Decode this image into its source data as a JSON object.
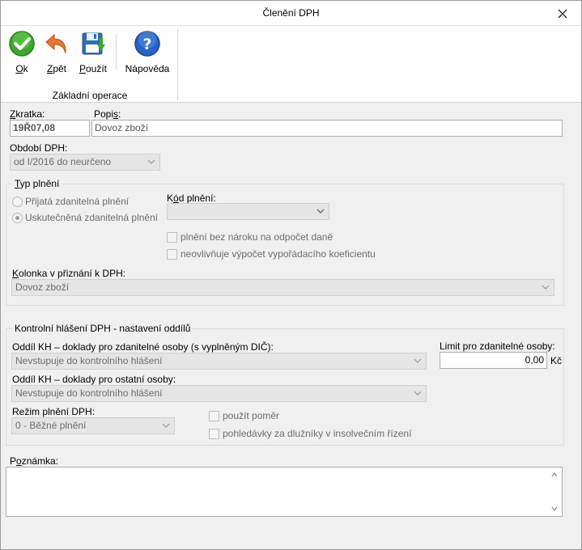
{
  "window": {
    "title": "Členění DPH"
  },
  "ribbon": {
    "buttons": {
      "ok": {
        "mnemonic": "O",
        "rest": "k"
      },
      "zpet": {
        "mnemonic": "Z",
        "rest": "pět"
      },
      "pouzit": {
        "mnemonic": "P",
        "rest": "oužít"
      },
      "napoveda": {
        "label": "Nápověda"
      }
    },
    "group_label": "Základní operace"
  },
  "form": {
    "zkratka": {
      "label_m": "Z",
      "label_rest": "kratka:",
      "value": "19Ř07,08"
    },
    "popis": {
      "label_a": "Popi",
      "label_m": "s",
      "label_rest": ":",
      "value": "Dovoz zboží"
    },
    "obdobi": {
      "label": "Období DPH:",
      "value": "od I/2016 do neurčeno"
    },
    "typ_plneni": {
      "title_m": "T",
      "title_rest": "yp plnění",
      "radio1": "Přijatá zdanitelná plnění",
      "radio2": "Uskutečněná zdanitelná plnění",
      "kod_label_a": "K",
      "kod_label_m": "ó",
      "kod_label_rest": "d plnění:",
      "kod_value": "",
      "check1": "plnění bez nároku na odpočet daně",
      "check2": "neovlivňuje výpočet vypořádacího koeficientu",
      "kolonka_label_m": "K",
      "kolonka_label_rest": "olonka v přiznání k DPH:",
      "kolonka_value": "Dovoz zboží"
    },
    "kontrolni": {
      "title": "Kontrolní hlášení DPH - nastavení oddílů",
      "oddil1_label": "Oddíl KH – doklady pro zdanitelné osoby (s vyplněným DIČ):",
      "oddil1_value": "Nevstupuje do kontrolního hlášení",
      "limit_label": "Limit pro zdanitelné osoby:",
      "limit_value": "0,00",
      "limit_unit": "Kč",
      "oddil2_label": "Oddíl KH – doklady pro ostatní osoby:",
      "oddil2_value": "Nevstupuje do kontrolního hlášení",
      "rezim_label": "Režim plnění DPH:",
      "rezim_value": "0 - Běžné plnění",
      "check_pomer": "použít poměr",
      "check_pohledavky": "pohledávky za dlužníky v insolvečním řízení"
    },
    "poznamka": {
      "label_a": "P",
      "label_m": "o",
      "label_rest": "známka:",
      "value": ""
    }
  },
  "colors": {
    "ok_green": "#3aa82c",
    "back_orange": "#e8762b",
    "save_blue": "#2d6fb7",
    "help_blue": "#2563c9"
  }
}
